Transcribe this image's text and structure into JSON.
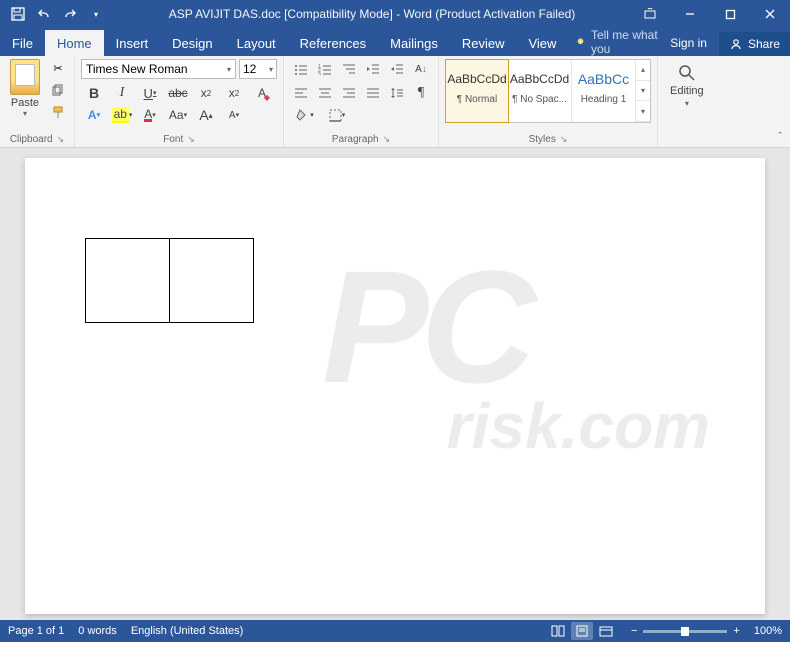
{
  "titlebar": {
    "title": "ASP AVIJIT DAS.doc [Compatibility Mode] - Word (Product Activation Failed)"
  },
  "tabs": {
    "file": "File",
    "home": "Home",
    "insert": "Insert",
    "design": "Design",
    "layout": "Layout",
    "references": "References",
    "mailings": "Mailings",
    "review": "Review",
    "view": "View",
    "tellme": "Tell me what you",
    "signin": "Sign in",
    "share": "Share"
  },
  "ribbon": {
    "clipboard": {
      "label": "Clipboard",
      "paste": "Paste"
    },
    "font": {
      "label": "Font",
      "name": "Times New Roman",
      "size": "12"
    },
    "paragraph": {
      "label": "Paragraph"
    },
    "styles": {
      "label": "Styles",
      "preview": "AaBbCcDd",
      "preview_h": "AaBbCc",
      "normal": "¶ Normal",
      "nospacing": "¶ No Spac...",
      "heading1": "Heading 1"
    },
    "editing": {
      "label": "Editing"
    }
  },
  "statusbar": {
    "page": "Page 1 of 1",
    "words": "0 words",
    "language": "English (United States)",
    "zoom": "100%"
  },
  "watermark": {
    "line1": "PC",
    "line2": "risk.com"
  }
}
